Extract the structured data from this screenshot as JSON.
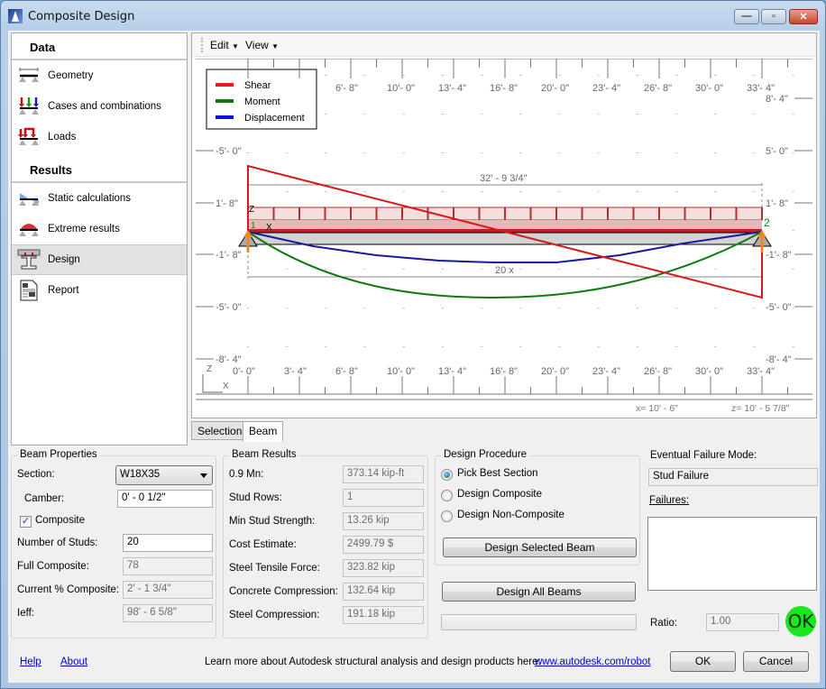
{
  "window": {
    "title": "Composite Design",
    "controls": {
      "minimize": "—",
      "maximize": "▫",
      "close": "✕"
    }
  },
  "sidebar": {
    "sections": [
      {
        "title": "Data",
        "items": [
          {
            "label": "Geometry",
            "icon": "geometry-icon"
          },
          {
            "label": "Cases and combinations",
            "icon": "load-cases-icon"
          },
          {
            "label": "Loads",
            "icon": "loads-icon"
          }
        ]
      },
      {
        "title": "Results",
        "items": [
          {
            "label": "Static calculations",
            "icon": "static-calculations-icon"
          },
          {
            "label": "Extreme results",
            "icon": "extreme-results-icon"
          },
          {
            "label": "Design",
            "icon": "design-beam-icon",
            "active": true
          },
          {
            "label": "Report",
            "icon": "report-icon"
          }
        ]
      }
    ]
  },
  "canvas": {
    "menus": [
      "Edit",
      "View"
    ],
    "legend": [
      {
        "label": "Shear",
        "color": "#e8191c"
      },
      {
        "label": "Moment",
        "color": "#107a10"
      },
      {
        "label": "Displacement",
        "color": "#1010d0"
      }
    ],
    "x_ticks": [
      "0'- 0\"",
      "3'- 4\"",
      "6'- 8\"",
      "10'- 0\"",
      "13'- 4\"",
      "16'- 8\"",
      "20'- 0\"",
      "23'- 4\"",
      "26'- 8\"",
      "30'- 0\"",
      "33'- 4\""
    ],
    "y_ticks_left": [
      "-5'- 0\"",
      "1'- 8\"",
      "-1'- 8\"",
      "-5'- 0\"",
      "-8'- 4\""
    ],
    "y_ticks_right": [
      "8'- 4\"",
      "5'- 0\"",
      "1'- 8\"",
      "-1'- 8\"",
      "-5'- 0\"",
      "-8'- 4\""
    ],
    "span_dimension": "32' - 9 3/4\"",
    "stud_dimension": "20 x",
    "node_labels": [
      "1",
      "2"
    ],
    "axis_labels": {
      "z": "Z",
      "x": "X"
    },
    "cursor_x": "x= 10' - 6\"",
    "cursor_z": "z= 10' - 5 7/8\""
  },
  "tabs": [
    {
      "label": "Selection",
      "active": false
    },
    {
      "label": "Beam",
      "active": true
    }
  ],
  "beam_properties": {
    "title": "Beam Properties",
    "section_label": "Section:",
    "section_value": "W18X35",
    "camber_label": "Camber:",
    "camber_value": "0' - 0 1/2\"",
    "composite_label": "Composite",
    "composite_checked": true,
    "studs_label": "Number of Studs:",
    "studs_value": "20",
    "full_composite_label": "Full Composite:",
    "full_composite_value": "78",
    "current_pct_label": "Current % Composite:",
    "current_pct_value": "2' - 1 3/4\"",
    "ieff_label": "Ieff:",
    "ieff_value": "98' - 6 5/8\""
  },
  "beam_results": {
    "title": "Beam Results",
    "rows": [
      {
        "label": "0.9 Mn:",
        "value": "373.14 kip-ft"
      },
      {
        "label": "Stud Rows:",
        "value": "1"
      },
      {
        "label": "Min Stud Strength:",
        "value": "13.26 kip"
      },
      {
        "label": "Cost Estimate:",
        "value": "2499.79 $"
      },
      {
        "label": "Steel Tensile Force:",
        "value": "323.82 kip"
      },
      {
        "label": "Concrete Compression:",
        "value": "132.64 kip"
      },
      {
        "label": "Steel Compression:",
        "value": "191.18 kip"
      }
    ]
  },
  "design_procedure": {
    "title": "Design Procedure",
    "options": [
      {
        "label": "Pick Best Section",
        "selected": true
      },
      {
        "label": "Design Composite",
        "selected": false
      },
      {
        "label": "Design Non-Composite",
        "selected": false
      }
    ],
    "design_selected_label": "Design Selected Beam",
    "design_all_label": "Design All Beams",
    "progress": 0
  },
  "failure": {
    "mode_label": "Eventual Failure Mode:",
    "mode_value": "Stud Failure",
    "failures_label": "Failures:",
    "ratio_label": "Ratio:",
    "ratio_value": "1.00",
    "status": "OK",
    "status_color": "#1be51b"
  },
  "footer": {
    "help": "Help",
    "about": "About",
    "promo_text": "Learn more about Autodesk structural analysis and design products here:",
    "promo_link": "www.autodesk.com/robot",
    "ok": "OK",
    "cancel": "Cancel"
  }
}
